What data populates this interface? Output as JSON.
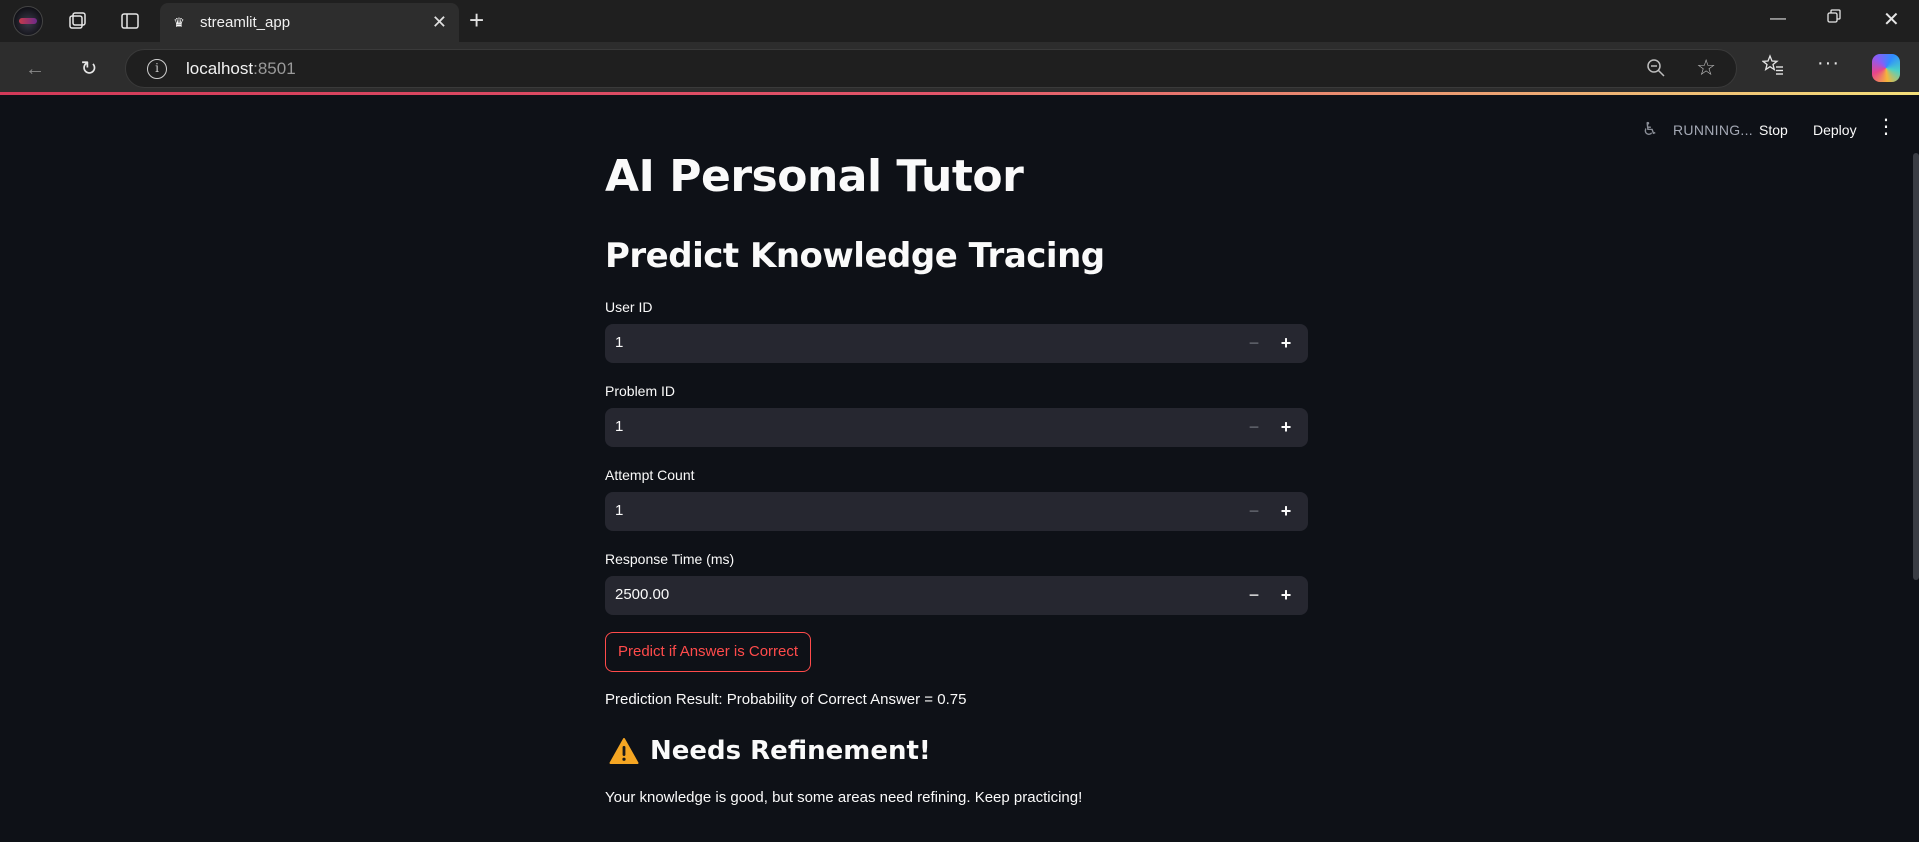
{
  "browser": {
    "tab_title": "streamlit_app",
    "url_host": "localhost",
    "url_port": ":8501"
  },
  "streamlit_header": {
    "status": "RUNNING...",
    "stop_label": "Stop",
    "deploy_label": "Deploy"
  },
  "page": {
    "title": "AI Personal Tutor",
    "subheader": "Predict Knowledge Tracing",
    "fields": [
      {
        "label": "User ID",
        "value": "1"
      },
      {
        "label": "Problem ID",
        "value": "1"
      },
      {
        "label": "Attempt Count",
        "value": "1"
      },
      {
        "label": "Response Time (ms)",
        "value": "2500.00"
      }
    ],
    "predict_button": "Predict if Answer is Correct",
    "result_text": "Prediction Result: Probability of Correct Answer = 0.75",
    "warning_title": "Needs Refinement!",
    "warning_text": "Your knowledge is good, but some areas need refining. Keep practicing!"
  },
  "colors": {
    "background": "#0e1117",
    "input_background": "#262730",
    "primary": "#ff4b4b",
    "warning_icon": "#f5a623"
  }
}
